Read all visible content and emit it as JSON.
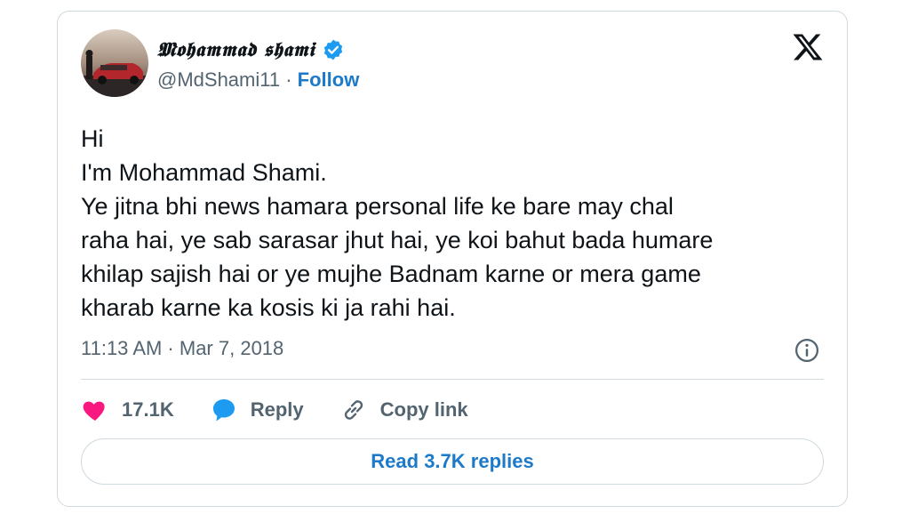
{
  "author": {
    "name": "𝕸𝖔𝖍𝖆𝖒𝖒𝖆𝖉 𝖘𝖍𝖆𝖒𝖎",
    "handle": "@MdShami11",
    "separator": "·",
    "follow_label": "Follow"
  },
  "tweet": {
    "text": "Hi\nI'm Mohammad Shami.\nYe jitna bhi news hamara personal life ke bare may chal\nraha hai, ye sab sarasar jhut hai, ye koi bahut bada humare\nkhilap sajish hai or ye mujhe Badnam karne or mera game\nkharab karne ka kosis ki ja rahi hai.",
    "timestamp": "11:13 AM · Mar 7, 2018"
  },
  "actions": {
    "likes": "17.1K",
    "reply_label": "Reply",
    "copy_label": "Copy link"
  },
  "read_replies_label": "Read 3.7K replies",
  "icons": {
    "brand": "x-logo-icon",
    "verified": "verified-badge-icon",
    "info": "info-icon",
    "heart": "heart-icon",
    "reply": "reply-bubble-icon",
    "copy": "link-icon"
  },
  "colors": {
    "accent": "#1d9bf0",
    "link": "#1d7ac9",
    "heart": "#f91880",
    "muted": "#536471"
  }
}
